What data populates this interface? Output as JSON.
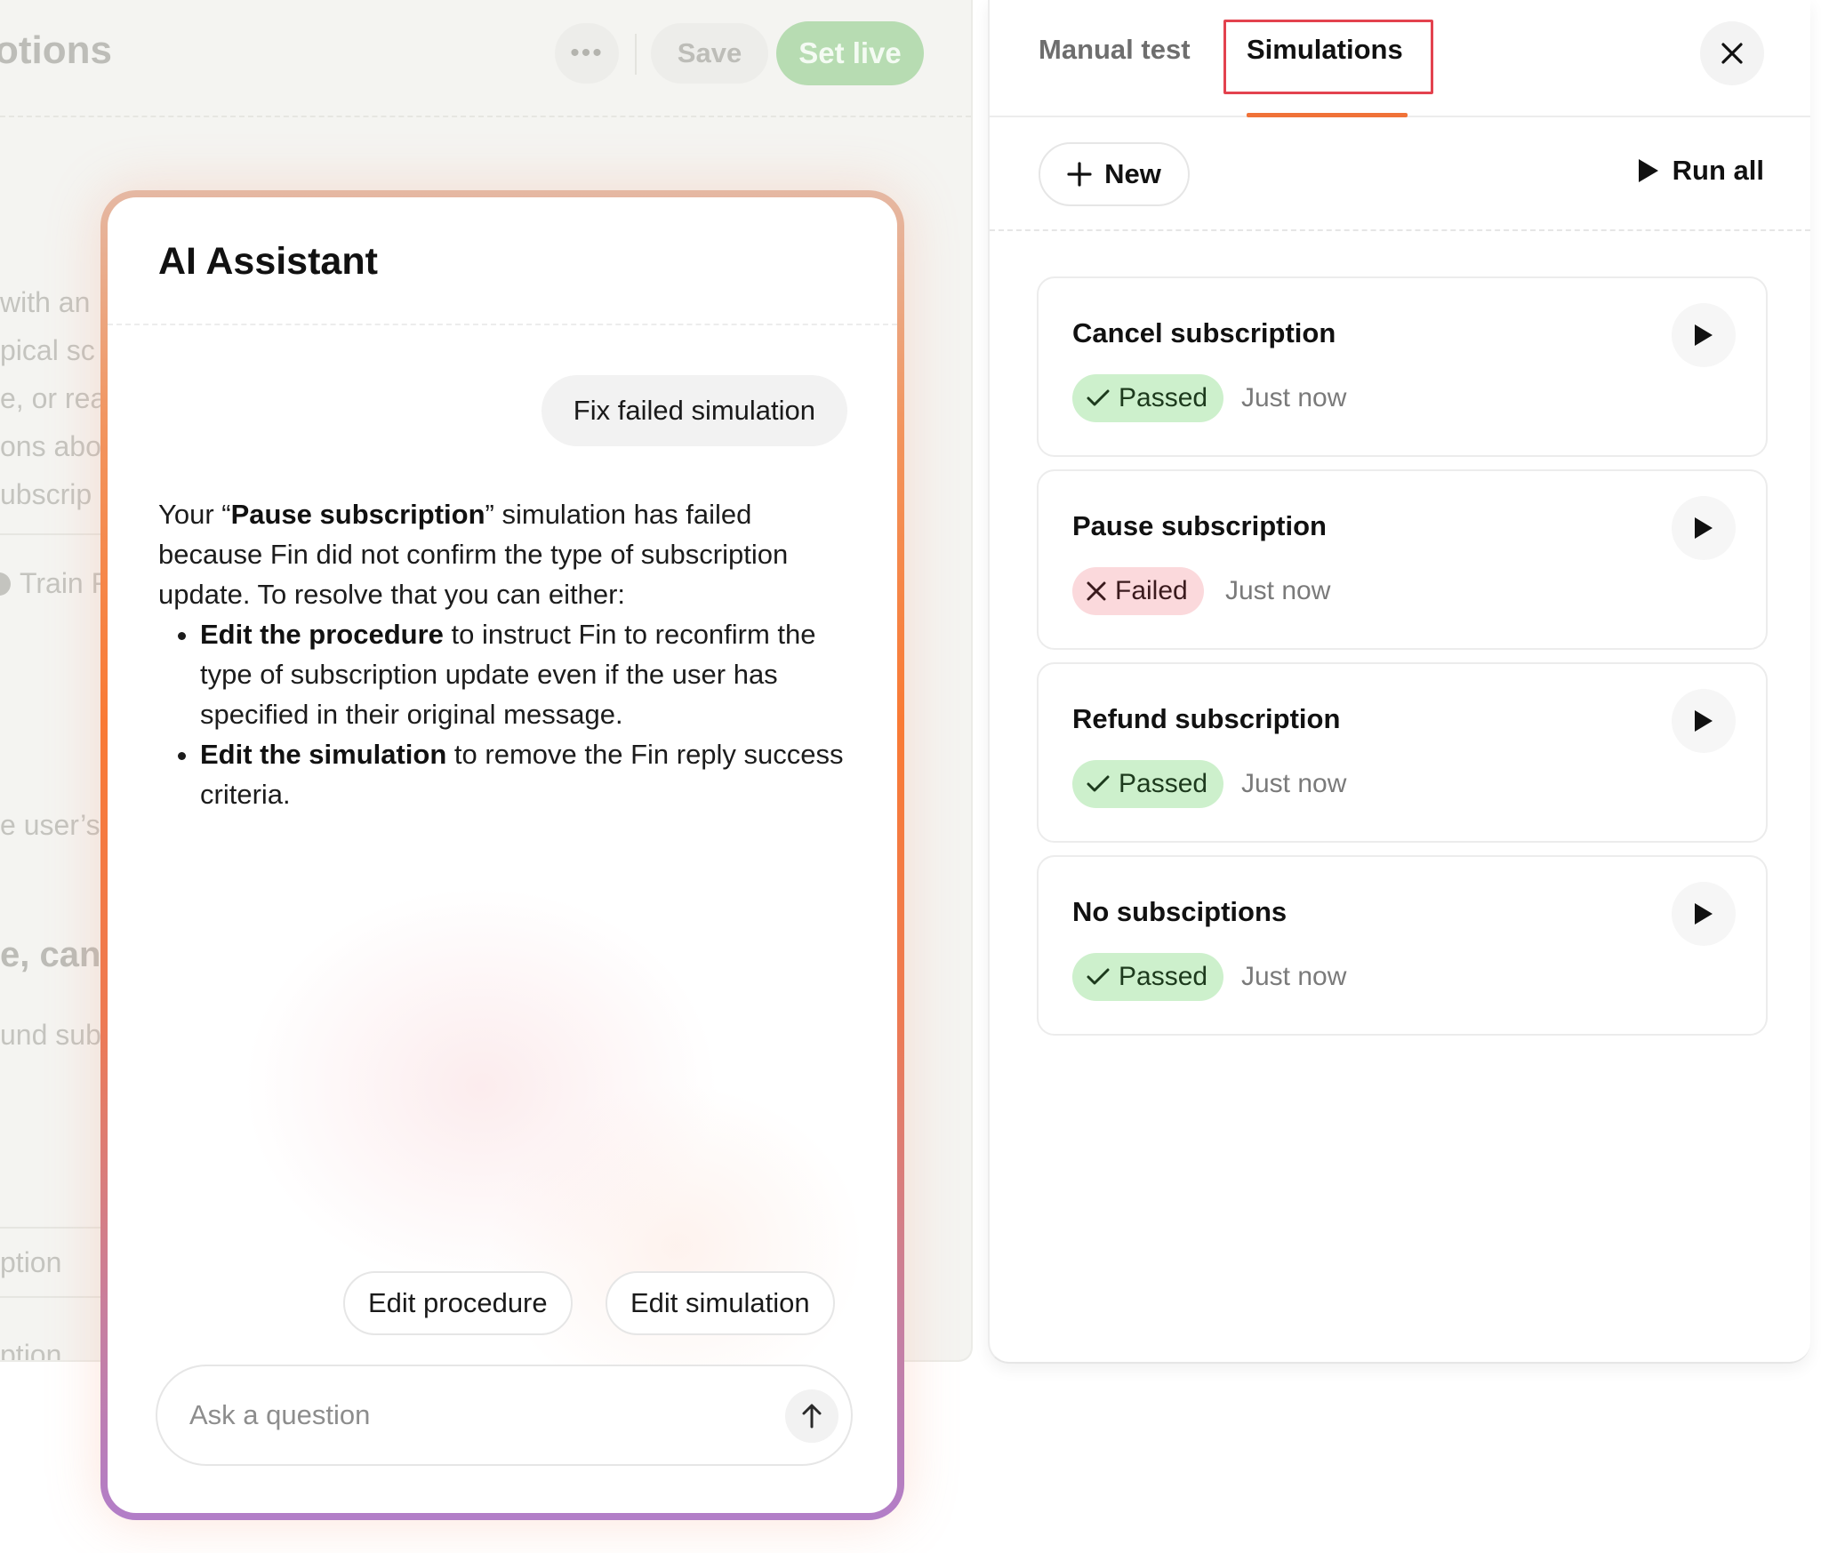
{
  "editor": {
    "title_fragment": "otions",
    "save_label": "Save",
    "set_live_label": "Set live",
    "fragments": [
      "with an",
      "pical sc",
      "e, or rea",
      "ons abou",
      "ubscrip",
      "Train F",
      "e user’s",
      "e, canc",
      "und sub",
      "ption",
      "ption"
    ]
  },
  "assistant": {
    "title": "AI Assistant",
    "user_message": "Fix failed simulation",
    "message": {
      "intro_before": "Your “",
      "intro_bold": "Pause subscription",
      "intro_after": "” simulation has failed because Fin did not confirm the type of subscription update. To resolve that you can either:",
      "bullets": [
        {
          "bold": "Edit the procedure",
          "text": " to instruct Fin to reconfirm the type of subscription update even if the user has specified in their original message."
        },
        {
          "bold": "Edit the simulation",
          "text": " to remove the Fin reply success criteria."
        }
      ]
    },
    "actions": [
      "Edit procedure",
      "Edit simulation"
    ],
    "input_placeholder": "Ask a question"
  },
  "panel": {
    "tabs": [
      {
        "label": "Manual test",
        "active": false
      },
      {
        "label": "Simulations",
        "active": true
      }
    ],
    "new_label": "New",
    "run_all_label": "Run all",
    "simulations": [
      {
        "name": "Cancel subscription",
        "status": "Passed",
        "time": "Just now"
      },
      {
        "name": "Pause subscription",
        "status": "Failed",
        "time": "Just now"
      },
      {
        "name": "Refund subscription",
        "status": "Passed",
        "time": "Just now"
      },
      {
        "name": "No subsciptions",
        "status": "Passed",
        "time": "Just now"
      }
    ]
  },
  "icons": {
    "more": "more-horizontal-icon",
    "close": "close-icon",
    "plus": "plus-icon",
    "play": "play-icon",
    "check": "check-icon",
    "x": "x-icon",
    "send": "arrow-up-icon"
  },
  "colors": {
    "accent_tab": "#f07238",
    "tab_highlight": "#e3424e",
    "passed_bg": "#cdf0cc",
    "failed_bg": "#fbd9dc",
    "set_live": "#b7dcb2"
  }
}
